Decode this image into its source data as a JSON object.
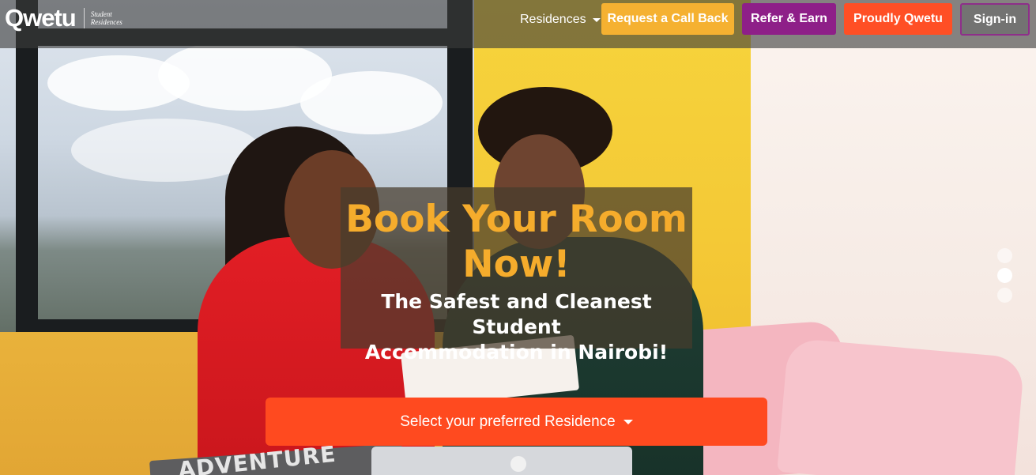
{
  "brand": {
    "logo_text": "Qwetu",
    "logo_sub_line1": "Student",
    "logo_sub_line2": "Residences"
  },
  "nav": {
    "residences_label": "Residences",
    "request_callback_label": "Request a Call Back",
    "refer_earn_label": "Refer & Earn",
    "proudly_qwetu_label": "Proudly Qwetu",
    "signin_label": "Sign-in"
  },
  "hero": {
    "title_line1": "Book Your Room",
    "title_line2": "Now!",
    "subtitle_line1": "The Safest and Cleanest Student",
    "subtitle_line2": "Accommodation in Nairobi!",
    "image_text": "ADVENTURE"
  },
  "cta": {
    "select_residence_label": "Select your preferred Residence"
  },
  "carousel": {
    "slide_count": 3,
    "active_index": 1
  },
  "colors": {
    "orange_cta": "#ff4a1f",
    "yellow_button": "#f5b131",
    "purple_button": "#8e1f88",
    "orange_button": "#ff4f25",
    "title_color": "#f5ac2c"
  },
  "icons": {
    "residences_dropdown": "caret-down-icon",
    "select_dropdown": "caret-down-icon"
  }
}
